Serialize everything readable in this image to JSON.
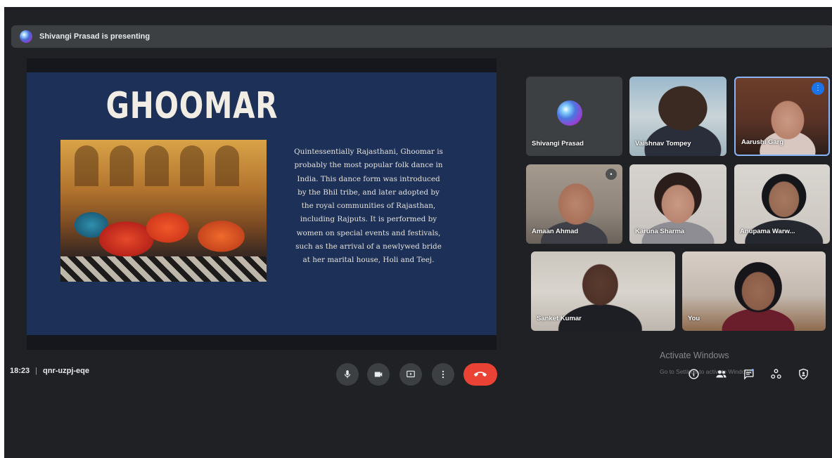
{
  "presenting": {
    "text": "Shivangi Prasad is presenting"
  },
  "slide": {
    "title": "GHOOMAR",
    "body_lines": [
      "Quintessentially Rajasthani, Ghoomar is",
      "probably the most popular folk dance in",
      "India. This dance form was introduced",
      "by the Bhil tribe, and later adopted by",
      "the royal communities of Rajasthan,",
      "including Rajputs. It is performed by",
      "women on special events and festivals,",
      "such as the arrival of a newlywed bride",
      "at her marital house, Holi and Teej."
    ]
  },
  "participants": [
    {
      "name": "Shivangi Prasad"
    },
    {
      "name": "Vaishnav Tompey"
    },
    {
      "name": "Aarushi Garg"
    },
    {
      "name": "Amaan Ahmad"
    },
    {
      "name": "Karuna Sharma"
    },
    {
      "name": "Anupama Warw..."
    },
    {
      "name": "Sanket Kumar"
    },
    {
      "name": "You"
    }
  ],
  "meeting": {
    "time": "18:23",
    "separator": "|",
    "code": "qnr-uzpj-eqe"
  },
  "controls": {
    "mic": "mic-icon",
    "camera": "camera-icon",
    "present": "present-icon",
    "more": "more-options-icon",
    "end": "end-call-icon"
  },
  "side_controls": [
    "info-icon",
    "people-icon",
    "chat-icon",
    "activities-icon",
    "host-controls-icon"
  ],
  "watermark": {
    "title": "Activate Windows",
    "subtitle": "Go to Settings to activate Windows."
  },
  "colors": {
    "background": "#202124",
    "end_call": "#ea4335",
    "accent": "#8ab4f8",
    "slide_bg": "#1d3058"
  }
}
